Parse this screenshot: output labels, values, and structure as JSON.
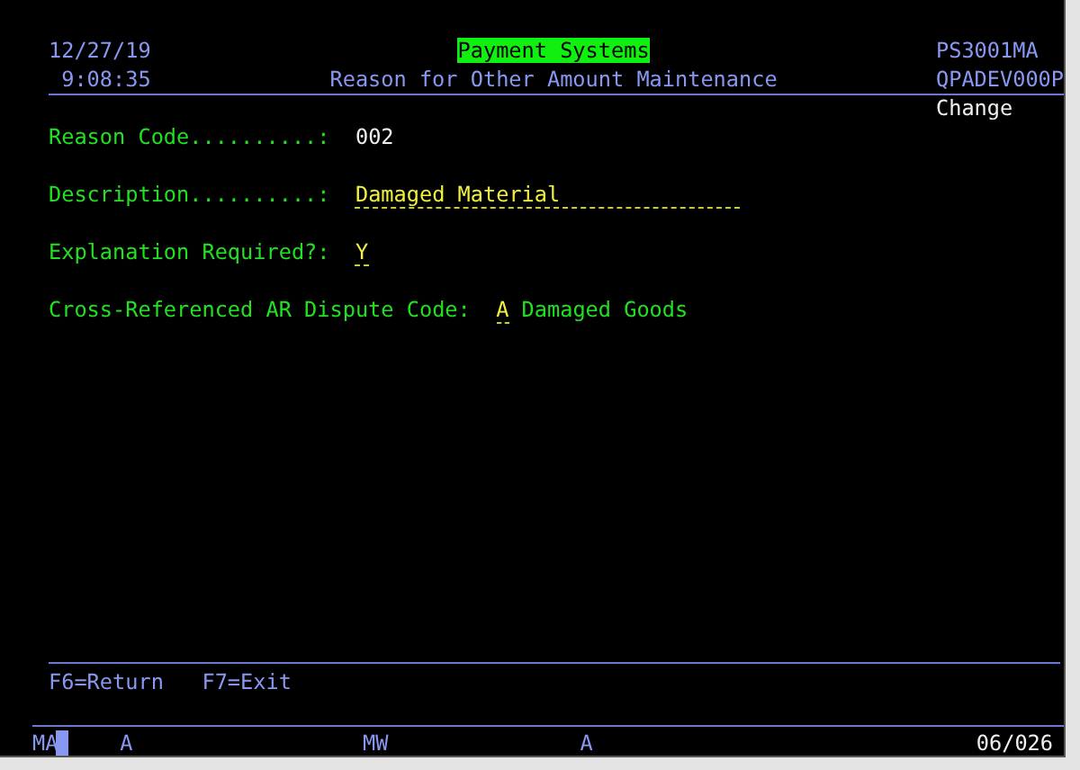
{
  "header": {
    "date": "12/27/19",
    "time": "9:08:35",
    "system": "Payment Systems",
    "screen_title": "Reason for Other Amount Maintenance",
    "program": "PS3001MA",
    "device": "QPADEV000P",
    "mode": "Change"
  },
  "fields": [
    {
      "kind": "display",
      "label": "Reason Code..........:",
      "value": "002"
    },
    {
      "kind": "text-input",
      "label": "Description..........:",
      "value": "Damaged Material"
    },
    {
      "kind": "code-input",
      "label": "Explanation Required?:",
      "value": "Y"
    },
    {
      "kind": "code-input",
      "label": "Cross-Referenced AR Dispute Code:",
      "value": "A",
      "note": "Damaged Goods"
    }
  ],
  "function_keys": [
    "F6=Return",
    "F7=Exit"
  ],
  "status_bar": {
    "mode": "MA",
    "items": [
      "A",
      "MW",
      "A"
    ],
    "position": "06/026"
  }
}
